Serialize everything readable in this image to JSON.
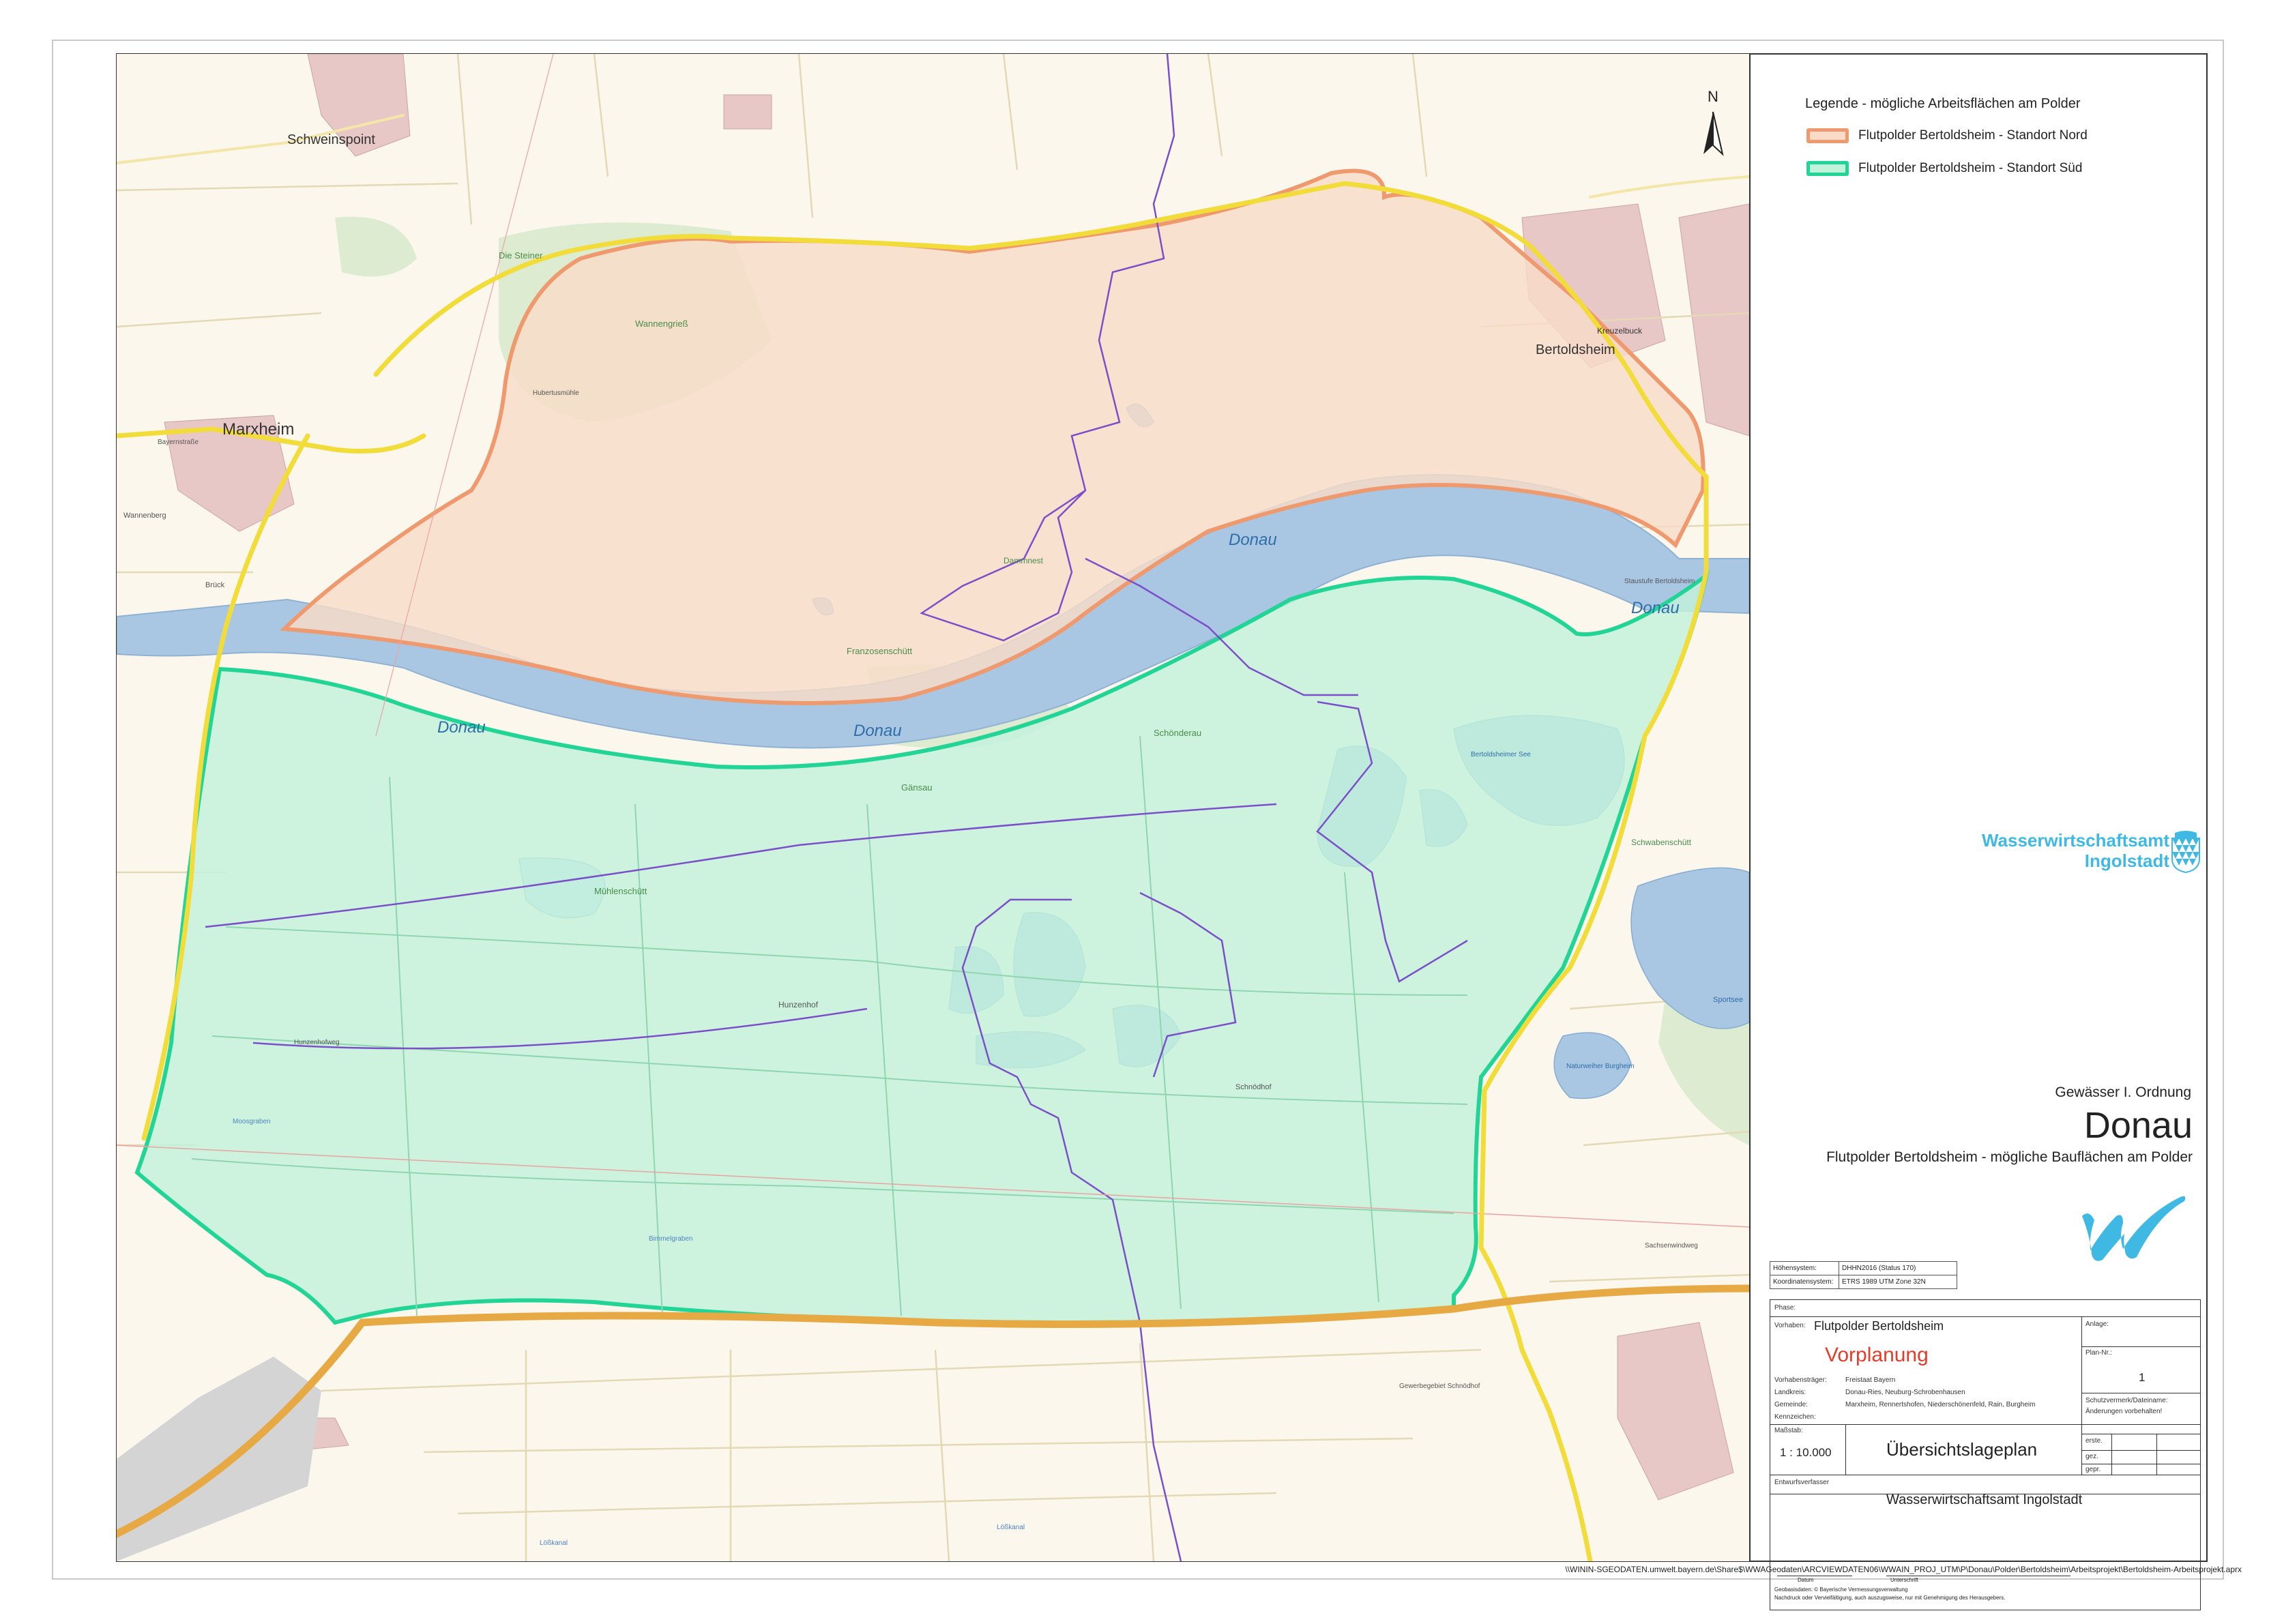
{
  "map": {
    "places": {
      "schweinspoint": "Schweinspoint",
      "marxheim": "Marxheim",
      "bertoldsheim": "Bertoldsheim",
      "kreuzelbuck": "Kreuzelbuck",
      "die_steiner": "Die Steiner",
      "wannengrieß": "Wannengrieß",
      "hubertusmühle": "Hubertusmühle",
      "dammnest": "Dammnest",
      "franzosenschütt": "Franzosenschütt",
      "schönderau": "Schönderau",
      "gänsau": "Gänsau",
      "mühlenschütt": "Mühlenschütt",
      "hunzenhof": "Hunzenhof",
      "hunzenhofweg": "Hunzenhofweg",
      "moosgraben": "Moosgraben",
      "schwabenschütt": "Schwabenschütt",
      "bertoldsheimer_see": "Bertoldsheimer See",
      "naturweiher_burgheim": "Naturweiher Burgheim",
      "sportsee": "Sportsee",
      "staustufe": "Staustufe Bertoldsheim",
      "wannenberg": "Wannenberg",
      "brück": "Brück",
      "schnödhof": "Schnödhof",
      "lohkanal": "Lößkanal",
      "gewerbegebiet": "Gewerbegebiet Schnödhof",
      "bayerstrasse": "Bayernstraße",
      "sachsenwindweg": "Sachsenwindweg",
      "bimmelgraben": "Bimmelgraben"
    },
    "river": {
      "donau": "Donau"
    },
    "north_arrow": "N"
  },
  "legend": {
    "title": "Legende - mögliche Arbeitsflächen am Polder",
    "items": [
      {
        "label": "Flutpolder Bertoldsheim - Standort Nord",
        "fill": "#f8dcc8",
        "stroke": "#ef9a6e"
      },
      {
        "label": "Flutpolder Bertoldsheim - Standort Süd",
        "fill": "#c2f2dc",
        "stroke": "#22d596"
      }
    ]
  },
  "agency": {
    "line1": "Wasserwirtschaftsamt",
    "line2": "Ingolstadt",
    "color": "#3fb9e4"
  },
  "title_block": {
    "category": "Gewässer I. Ordnung",
    "river": "Donau",
    "subtitle": "Flutpolder Bertoldsheim - mögliche Bauflächen am Polder"
  },
  "info": {
    "rows": [
      {
        "key": "Höhensystem:",
        "value": "DHHN2016 (Status 170)"
      },
      {
        "key": "Koordinatensystem:",
        "value": "ETRS 1989 UTM Zone 32N"
      }
    ]
  },
  "plan": {
    "phase_label": "Phase:",
    "vorhaben_label": "Vorhaben:",
    "vorhaben": "Flutpolder Bertoldsheim",
    "phase_value": "Vorplanung",
    "phase_color": "#e23c2b",
    "anlage_label": "Anlage:",
    "plan_nr_label": "Plan-Nr.:",
    "plan_nr": "1",
    "vorhabenstraeger_label": "Vorhabensträger:",
    "vorhabenstraeger": "Freistaat Bayern",
    "landkreis_label": "Landkreis:",
    "landkreis": "Donau-Ries, Neuburg-Schrobenhausen",
    "gemeinde_label": "Gemeinde:",
    "gemeinde": "Marxheim, Rennertshofen, Niederschönenfeld, Rain, Burgheim",
    "kennzeichen_label": "Kennzeichen:",
    "schutz_label": "Schutzvermerk/Dateiname:",
    "schutz_value": "Änderungen vorbehalten!",
    "massstab_label": "Maßstab:",
    "massstab": "1 : 10.000",
    "doc_title": "Übersichtslageplan",
    "erstellt": "erste.",
    "gez": "gez.",
    "gepr": "gepr.",
    "entwurf_label": "Entwurfsverfasser",
    "entwurf": "Wasserwirtschaftsamt Ingolstadt",
    "sign_left": "Datum",
    "sign_right": "Unterschrift",
    "copyright1": "Geobasisdaten: © Bayerische Vermessungsverwaltung",
    "copyright2": "Nachdruck oder Vervielfältigung, auch auszugsweise, nur mit Genehmigung des Herausgebers."
  },
  "footer_path": "\\\\WININ-SGEODATEN.umwelt.bayern.de\\Share$\\WWAGeodaten\\ARCVIEWDATEN06\\WWAIN_PROJ_UTM\\P\\Donau\\Polder\\Bertoldsheim\\Arbeitsprojekt\\Bertoldsheim-Arbeitsprojekt.aprx"
}
